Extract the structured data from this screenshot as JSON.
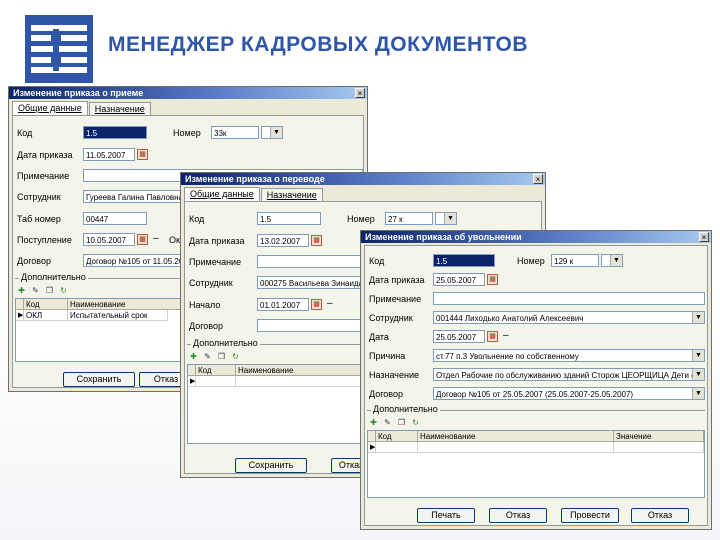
{
  "header": {
    "title": "МЕНЕДЖЕР КАДРОВЫХ ДОКУМЕНТОВ"
  },
  "colors": {
    "brand": "#2f56a8",
    "titlebar": "#0a246a"
  },
  "win1": {
    "title": "Изменение приказа о приеме",
    "tabs": [
      "Общие данные",
      "Назначение"
    ],
    "code_label": "Код",
    "code_value": "1.5",
    "number_label": "Номер",
    "number_value": "33к",
    "date_label": "Дата приказа",
    "date_value": "11.05.2007",
    "note_label": "Примечание",
    "note_value": "",
    "employee_label": "Сотрудник",
    "employee_value": "Гуреева Галина Павловна",
    "tab_label": "Таб номер",
    "tab_value": "00447",
    "hire_label": "Поступление",
    "hire_value": "10.05.2007",
    "hire_after": "Оклад",
    "contract_label": "Договор",
    "contract_value": "Договор №105 от 11.05.2007",
    "extra_label": "Дополнительно",
    "grid_headers": [
      "Код",
      "Наименование"
    ],
    "grid_row": [
      "ОКЛ",
      "Испытательный срок"
    ],
    "btn_ok": "Сохранить",
    "btn_cancel": "Отказ"
  },
  "win2": {
    "title": "Изменение приказа о переводе",
    "tabs": [
      "Общие данные",
      "Назначение"
    ],
    "code_label": "Код",
    "code_value": "1.5",
    "number_label": "Номер",
    "number_value": "27 к",
    "date_label": "Дата приказа",
    "date_value": "13.02.2007",
    "note_label": "Примечание",
    "note_value": "",
    "employee_label": "Сотрудник",
    "employee_value": "000275 Васильева Зинаида Ив",
    "start_label": "Начало",
    "start_value": "01.01.2007",
    "contract_label": "Договор",
    "contract_value": "",
    "extra_label": "Дополнительно",
    "grid_headers": [
      "Код",
      "Наименование"
    ],
    "btn_ok": "Сохранить",
    "btn_cancel": "Отказ"
  },
  "win3": {
    "title": "Изменение приказа об увольнении",
    "code_label": "Код",
    "code_value": "1.5",
    "number_label": "Номер",
    "number_value": "129 к",
    "date_label": "Дата приказа",
    "date_value": "25.05.2007",
    "note_label": "Примечание",
    "note_value": "",
    "employee_label": "Сотрудник",
    "employee_value": "001444 Лиходько Анатолий Алексеевич",
    "date2_label": "Дата",
    "date2_value": "25.05.2007",
    "reason_label": "Причина",
    "reason_value": "ст.77 п.3 Увольнение по собственному",
    "assign_label": "Назначение",
    "assign_value": "Отдел Рабочие по обслуживанию зданий Сторож ЦЕОРЩИЦА Дети сот",
    "contract_label": "Договор",
    "contract_value": "Договор №105 от 25.05.2007 (25.05.2007-25.05.2007)",
    "extra_label": "Дополнительно",
    "grid_headers": [
      "Код",
      "Наименование",
      "Значение"
    ],
    "buttons": [
      "Печать",
      "Отказ",
      "Провести",
      "Отказ"
    ]
  }
}
